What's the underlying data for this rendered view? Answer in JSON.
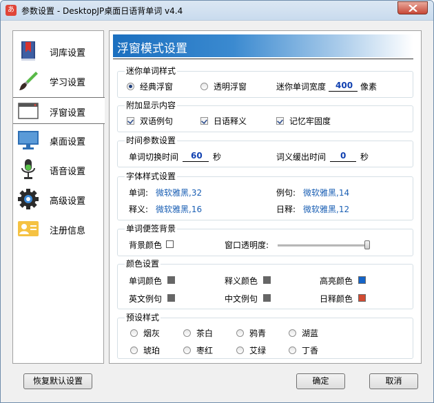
{
  "window": {
    "title": "参数设置 - DesktopJP桌面日语背单词 v4.4",
    "icon_char": "あ"
  },
  "sidebar": {
    "items": [
      {
        "label": "词库设置",
        "icon": "book-icon"
      },
      {
        "label": "学习设置",
        "icon": "brush-icon"
      },
      {
        "label": "浮窗设置",
        "icon": "window-icon"
      },
      {
        "label": "桌面设置",
        "icon": "monitor-icon"
      },
      {
        "label": "语音设置",
        "icon": "microphone-icon"
      },
      {
        "label": "高级设置",
        "icon": "gear-icon"
      },
      {
        "label": "注册信息",
        "icon": "id-card-icon"
      }
    ],
    "active": "浮窗设置"
  },
  "header": {
    "title": "浮窗模式设置"
  },
  "mini_style": {
    "title": "迷你单词样式",
    "option1": "经典浮窗",
    "option1_selected": true,
    "option2": "透明浮窗",
    "width_label": "迷你单词宽度",
    "width_value": "400",
    "width_unit": "像素"
  },
  "extra": {
    "title": "附加显示内容",
    "item1": "双语例句",
    "item2": "日语释义",
    "item3": "记忆牢固度"
  },
  "time": {
    "title": "时间参数设置",
    "switch_label": "单词切换时间",
    "switch_value": "60",
    "switch_unit": "秒",
    "delay_label": "词义缓出时间",
    "delay_value": "0",
    "delay_unit": "秒"
  },
  "font": {
    "title": "字体样式设置",
    "word_label": "单词:",
    "word_value": "微软雅黑,32",
    "example_label": "例句:",
    "example_value": "微软雅黑,14",
    "meaning_label": "释义:",
    "meaning_value": "微软雅黑,16",
    "jp_label": "日释:",
    "jp_value": "微软雅黑,12"
  },
  "background": {
    "title": "单词便签背景",
    "bg_color_label": "背景颜色",
    "opacity_label": "窗口透明度:",
    "opacity_level": 1.0
  },
  "colors": {
    "title": "颜色设置",
    "word_color_label": "单词颜色",
    "word_color": "#666666",
    "meaning_color_label": "释义颜色",
    "meaning_color": "#666666",
    "highlight_label": "高亮颜色",
    "highlight_color": "#1464c8",
    "en_example_label": "英文例句",
    "en_example_color": "#666666",
    "cn_example_label": "中文例句",
    "cn_example_color": "#666666",
    "jp_meaning_label": "日释颜色",
    "jp_meaning_color": "#d24b32"
  },
  "presets": {
    "title": "预设样式",
    "items": [
      "烟灰",
      "茶白",
      "鸦青",
      "湖蓝",
      "琥珀",
      "枣红",
      "艾绿",
      "丁香"
    ]
  },
  "buttons": {
    "restore": "恢复默认设置",
    "ok": "确定",
    "cancel": "取消"
  }
}
